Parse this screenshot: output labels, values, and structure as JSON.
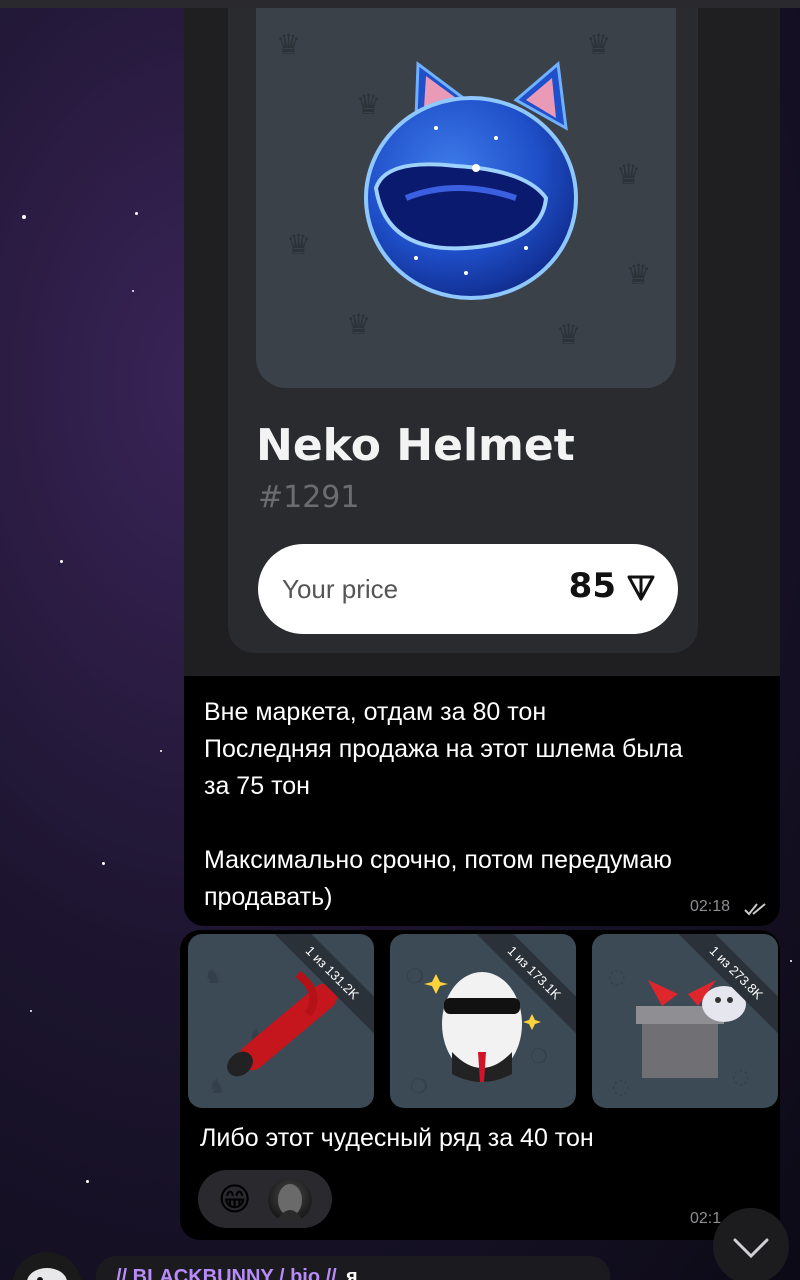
{
  "message1": {
    "gift_card": {
      "name": "Neko Helmet",
      "number": "#1291",
      "price_label": "Your price",
      "price_value": "85",
      "currency_icon": "ton-icon"
    },
    "text": "Вне маркета, отдам за 80 тон\nПоследняя продажа на этот шлема была\nза 75 тон\n\nМаксимально срочно, потом передумаю\nпродавать)",
    "time": "02:18",
    "status_icon": "double-check-icon"
  },
  "message2": {
    "gifts": [
      {
        "badge": "1 из 131.2K",
        "icon": "dynamite-stick-icon"
      },
      {
        "badge": "1 из 173.1K",
        "icon": "egg-agent-icon"
      },
      {
        "badge": "1 из 273.8K",
        "icon": "gift-box-icon"
      }
    ],
    "text": "Либо этот чудесный ряд за 40 тон",
    "time": "02:1",
    "reaction_emoji": "😁"
  },
  "next_message": {
    "sender": "// BLACKBUNNY / bio //",
    "extra": "я"
  },
  "colors": {
    "bubble": "#000000",
    "name_accent": "#b88cf7",
    "tile": "#3c4a55"
  }
}
